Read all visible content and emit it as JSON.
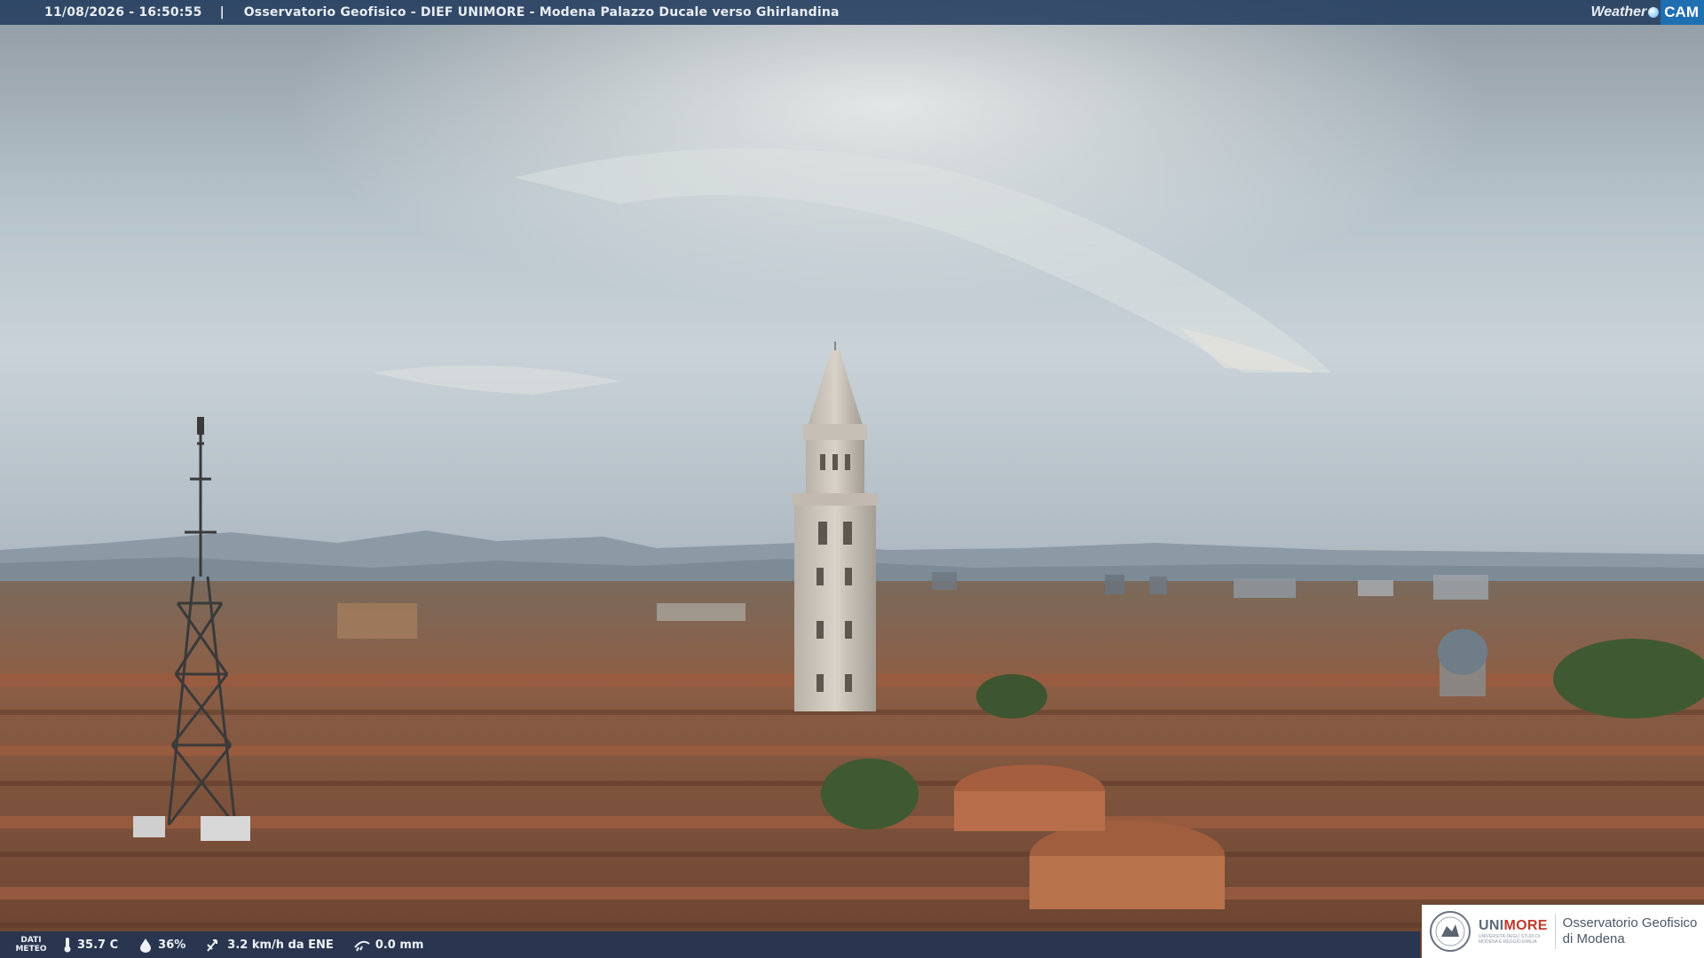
{
  "header": {
    "timestamp": "11/08/2026 - 16:50:55",
    "separator": "|",
    "title": "Osservatorio Geofisico - DIEF UNIMORE - Modena Palazzo Ducale verso Ghirlandina"
  },
  "brand": {
    "weather": "Weather",
    "cam": "CAM"
  },
  "weather_strip": {
    "label_line1": "DATI",
    "label_line2": "METEO",
    "temperature": "35.7 C",
    "humidity": "36%",
    "wind": "3.2 km/h da ENE",
    "rain": "0.0 mm"
  },
  "logo": {
    "uni_prefix": "UNI",
    "uni_suffix": "MORE",
    "uni_sub1": "UNIVERSITÀ DEGLI STUDI DI",
    "uni_sub2": "MODENA E REGGIO EMILIA",
    "obs_line1": "Osservatorio Geofisico",
    "obs_line2": "di Modena"
  },
  "colors": {
    "bar_bg": "#233c5f",
    "roof": "#9a5a3f",
    "sky": "#b9c4cc"
  }
}
